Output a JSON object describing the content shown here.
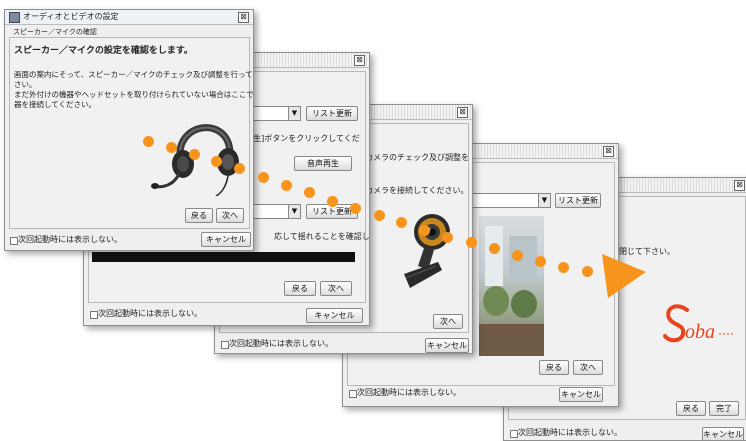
{
  "win1": {
    "title": "オーディオとビデオの設定",
    "group_label": "スピーカー／マイクの確認",
    "heading": "スピーカー／マイクの設定を確認をします。",
    "desc_line1": "画面の案内にそって、スピーカー／マイクのチェック及び調整を行って下",
    "desc_line2": "さい。",
    "desc_line3": "まだ外付けの機器やヘッドセットを取り付けられていない場合はここで機",
    "desc_line4": "器を接続してください。",
    "back": "戻る",
    "next": "次へ",
    "dont_show": "次回起動時には表示しない。",
    "cancel": "キャンセル"
  },
  "win2": {
    "refresh1": "リスト更新",
    "instruction": "[再生]ボタンをクリックしてくだ",
    "play": "音声再生",
    "refresh2": "リスト更新",
    "check_text": "応して揺れることを確認してく",
    "back": "戻る",
    "next": "次へ",
    "dont_show": "次回起動時には表示しない。",
    "cancel": "キャンセル"
  },
  "win3": {
    "line1": "カメラのチェック及び調整を",
    "line2": "カメラを接続してください。",
    "next": "次へ",
    "dont_show": "次回起動時には表示しない。",
    "cancel": "キャンセル"
  },
  "win4": {
    "refresh": "リスト更新",
    "back": "戻る",
    "next": "次へ",
    "dont_show": "次回起動時には表示しない。",
    "cancel": "キャンセル"
  },
  "win5": {
    "close_text": "を閉じて下さい。",
    "logo": "Soba",
    "back": "戻る",
    "finish": "完了",
    "dont_show": "次回起動時には表示しない。",
    "cancel": "キャンセル"
  },
  "colors": {
    "arrow_orange": "#f7941d",
    "logo_red": "#e8431e"
  },
  "icons": {
    "headset": "headset-icon",
    "webcam": "webcam-icon",
    "close": "close-icon",
    "dropdown": "dropdown-arrow-icon"
  }
}
